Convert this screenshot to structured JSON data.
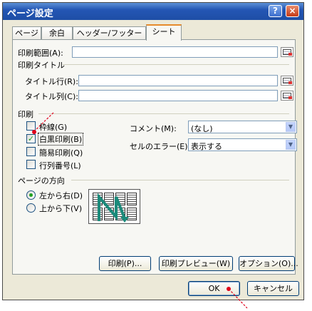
{
  "dialog": {
    "title": "ページ設定",
    "help_label": "?",
    "close_label": "×"
  },
  "tabs": [
    "ページ",
    "余白",
    "ヘッダー/フッター",
    "シート"
  ],
  "active_tab": "シート",
  "sheet": {
    "print_area_label": "印刷範囲(A):",
    "print_titles_label": "印刷タイトル",
    "title_rows_label": "タイトル行(R):",
    "title_cols_label": "タイトル列(C):",
    "print_section_label": "印刷",
    "options": [
      {
        "label": "枠線(G)",
        "checked": false
      },
      {
        "label": "白黒印刷(B)",
        "checked": true
      },
      {
        "label": "簡易印刷(Q)",
        "checked": false
      },
      {
        "label": "行列番号(L)",
        "checked": false
      }
    ],
    "comments_label": "コメント(M):",
    "comments_value": "(なし)",
    "cell_errors_label": "セルのエラー(E):",
    "cell_errors_value": "表示する",
    "page_order_label": "ページの方向",
    "order_options": [
      {
        "label": "左から右(D)",
        "selected": true
      },
      {
        "label": "上から下(V)",
        "selected": false
      }
    ]
  },
  "buttons": {
    "print": "印刷(P)...",
    "preview": "印刷プレビュー(W)",
    "options": "オプション(O)...",
    "ok": "OK",
    "cancel": "キャンセル"
  },
  "colors": {
    "title_bar": "#2456b4",
    "accent_check": "#21a121",
    "tab_highlight": "#e68b2c",
    "annotation": "#e0001b"
  }
}
